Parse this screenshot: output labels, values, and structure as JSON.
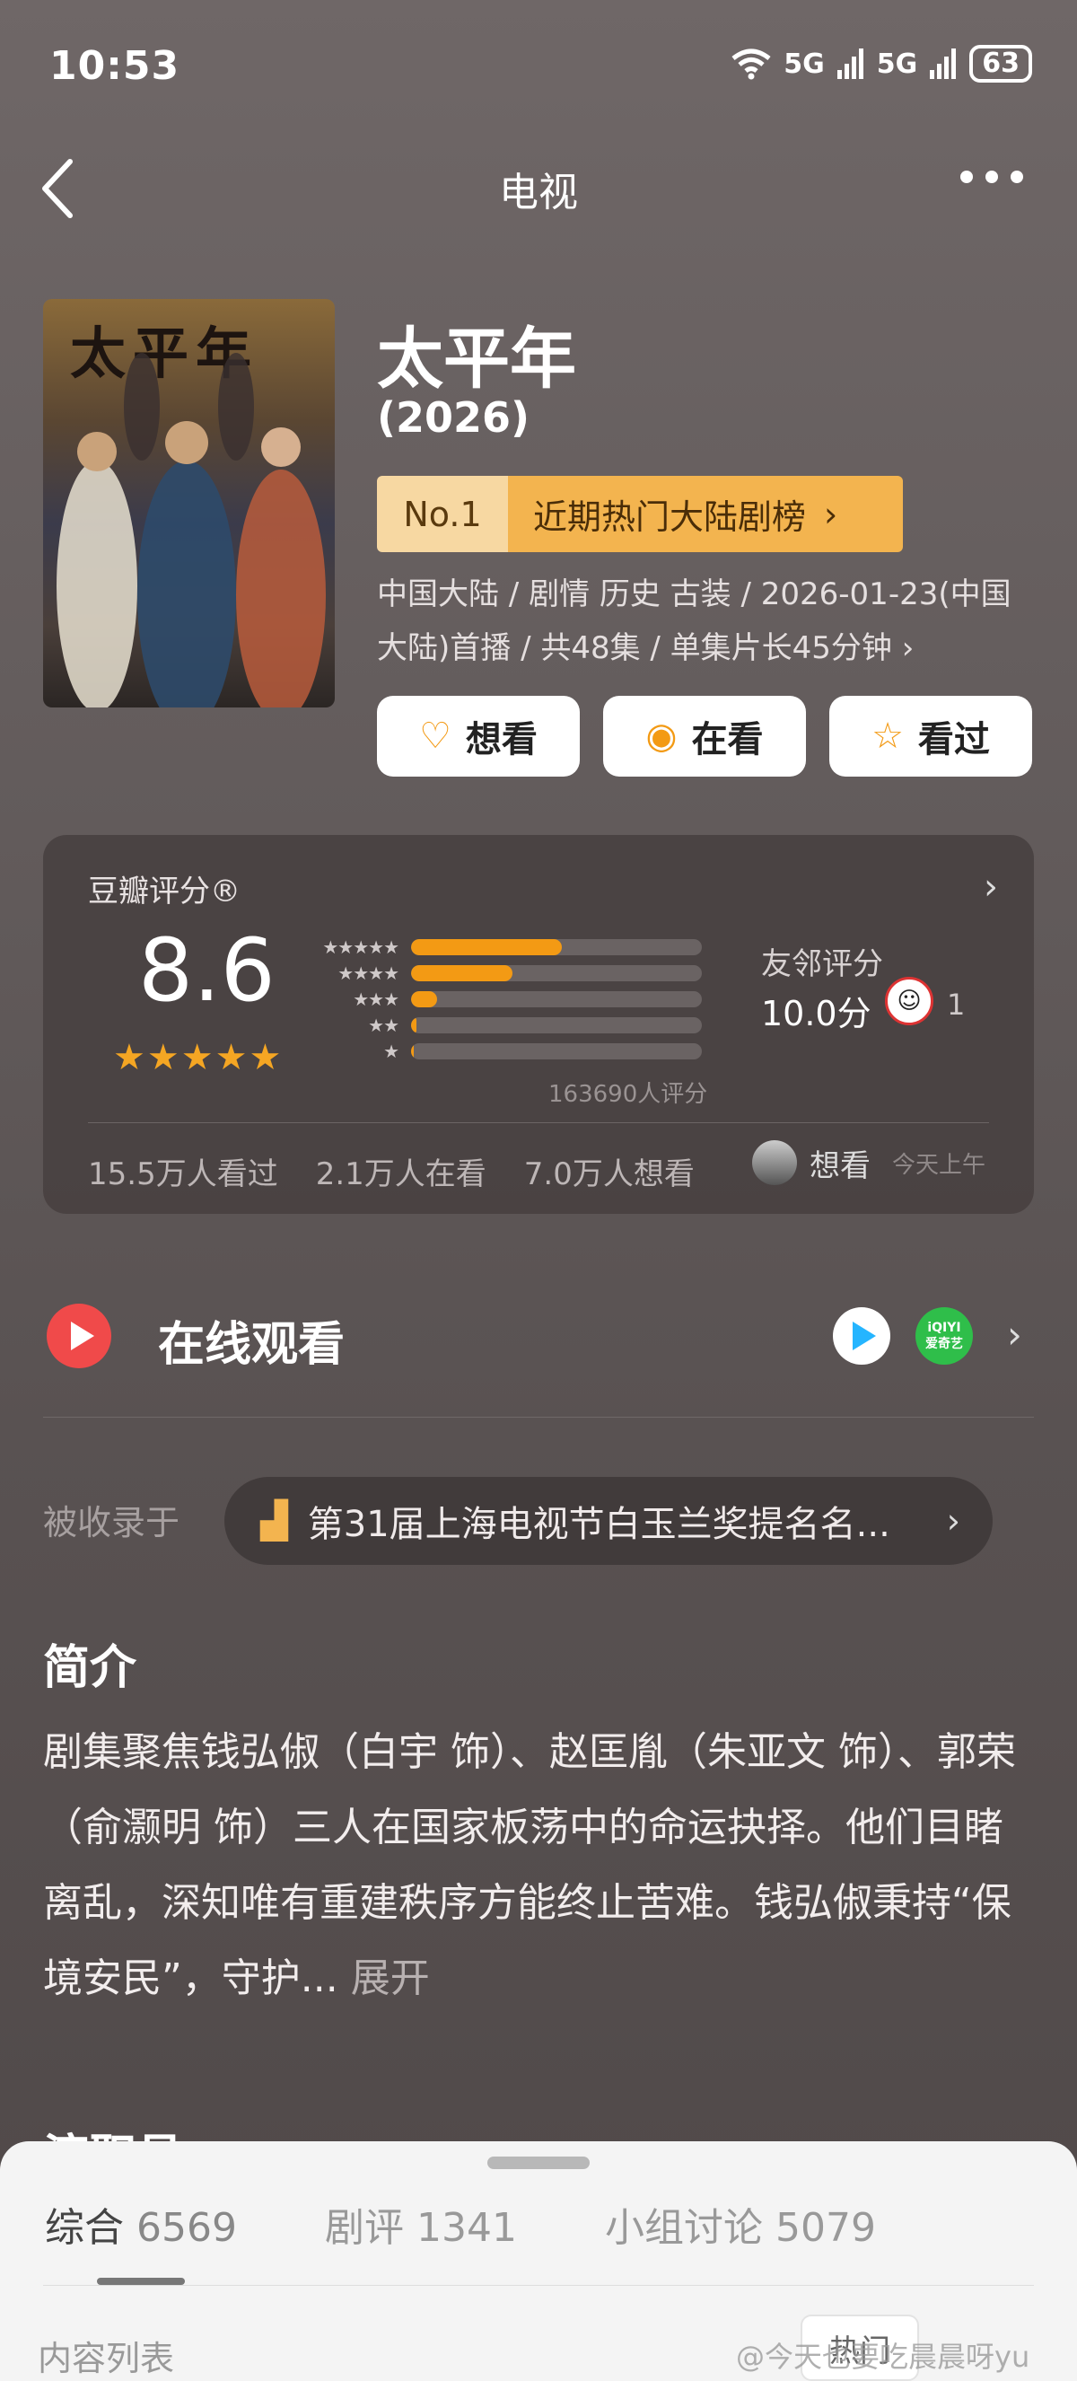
{
  "status_bar": {
    "time": "10:53",
    "net1": "5G",
    "net2": "5G",
    "battery": "63"
  },
  "nav": {
    "title": "电视"
  },
  "show": {
    "poster_title": "太平年",
    "title": "太平年",
    "year": "(2026)",
    "rank_no": "No.1",
    "rank_text": "近期热门大陆剧榜",
    "meta": "中国大陆 / 剧情 历史 古装 / 2026-01-23(中国大陆)首播 / 共48集 / 单集片长45分钟 ›"
  },
  "actions": {
    "want": "想看",
    "watching": "在看",
    "watched": "看过"
  },
  "rating": {
    "label": "豆瓣评分®",
    "score": "8.6",
    "stars": "★★★★★",
    "count": "163690人评分",
    "distribution": [
      52,
      35,
      9,
      2,
      1
    ],
    "friends_label": "友邻评分",
    "friends_score": "10.0分",
    "friends_count": "1",
    "stats": [
      "15.5万人看过",
      "2.1万人在看",
      "7.0万人想看"
    ],
    "user_action": "想看",
    "user_time": "今天上午"
  },
  "online": {
    "title": "在线观看",
    "provider2": "爱奇艺"
  },
  "included": {
    "label": "被收录于",
    "text": "第31届上海电视节白玉兰奖提名名..."
  },
  "synopsis": {
    "title": "简介",
    "text": "剧集聚焦钱弘俶（白宇 饰）、赵匡胤（朱亚文 饰）、郭荣（俞灏明 饰）三人在国家板荡中的命运抉择。他们目睹离乱，深知唯有重建秩序方能终止苦难。钱弘俶秉持“保境安民”，守护...",
    "more": "展开"
  },
  "sheet": {
    "peek": "演职员",
    "tabs": [
      {
        "label": "综合",
        "count": "6569"
      },
      {
        "label": "剧评",
        "count": "1341"
      },
      {
        "label": "小组讨论",
        "count": "5079"
      }
    ],
    "content_label": "内容列表",
    "hot_button": "热门"
  },
  "watermark": "@今天也要吃晨晨呀yu",
  "colors": {
    "accent": "#f39a14",
    "play": "#f04a4a",
    "rank_bg": "#f3b44f"
  }
}
